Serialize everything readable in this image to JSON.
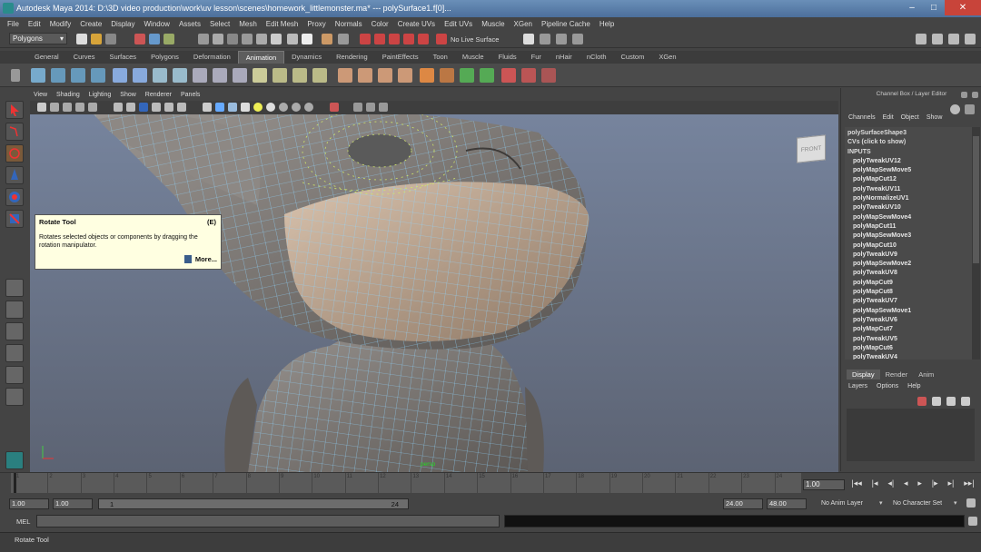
{
  "window": {
    "title": "Autodesk Maya 2014: D:\\3D video production\\work\\uv lesson\\scenes\\homework_littlemonster.ma*   ---   polySurface1.f[0]..."
  },
  "menubar": {
    "items": [
      "File",
      "Edit",
      "Modify",
      "Create",
      "Display",
      "Window",
      "Assets",
      "Select",
      "Mesh",
      "Edit Mesh",
      "Proxy",
      "Normals",
      "Color",
      "Create UVs",
      "Edit UVs",
      "Muscle",
      "XGen",
      "Pipeline Cache",
      "Help"
    ]
  },
  "statusline": {
    "mode": "Polygons",
    "live_surface": "No Live Surface"
  },
  "shelf": {
    "tabs": [
      "General",
      "Curves",
      "Surfaces",
      "Polygons",
      "Deformation",
      "Animation",
      "Dynamics",
      "Rendering",
      "PaintEffects",
      "Toon",
      "Muscle",
      "Fluids",
      "Fur",
      "nHair",
      "nCloth",
      "Custom",
      "XGen"
    ],
    "active_tab": "Animation"
  },
  "viewport": {
    "menu": [
      "View",
      "Shading",
      "Lighting",
      "Show",
      "Renderer",
      "Panels"
    ],
    "viewcube_label": "FRONT",
    "camera_label": "persp"
  },
  "tooltip": {
    "title": "Rotate Tool",
    "hotkey": "(E)",
    "description": "Rotates selected objects or components by dragging the rotation manipulator.",
    "more": "More..."
  },
  "channel_box": {
    "header": "Channel Box / Layer Editor",
    "tabs": [
      "Channels",
      "Edit",
      "Object",
      "Show"
    ],
    "shape": "polySurfaceShape3",
    "cvs": "CVs (click to show)",
    "inputs_label": "INPUTS",
    "inputs": [
      "polyTweakUV12",
      "polyMapSewMove5",
      "polyMapCut12",
      "polyTweakUV11",
      "polyNormalizeUV1",
      "polyTweakUV10",
      "polyMapSewMove4",
      "polyMapCut11",
      "polyMapSewMove3",
      "polyMapCut10",
      "polyTweakUV9",
      "polyMapSewMove2",
      "polyTweakUV8",
      "polyMapCut9",
      "polyMapCut8",
      "polyTweakUV7",
      "polyMapSewMove1",
      "polyTweakUV6",
      "polyMapCut7",
      "polyTweakUV5",
      "polyMapCut6",
      "polyTweakUV4"
    ]
  },
  "layer_editor": {
    "tabs": [
      "Display",
      "Render",
      "Anim"
    ],
    "active_tab": "Display",
    "menu": [
      "Layers",
      "Options",
      "Help"
    ]
  },
  "time_slider": {
    "ticks": [
      "1",
      "2",
      "3",
      "4",
      "5",
      "6",
      "7",
      "8",
      "9",
      "10",
      "11",
      "12",
      "13",
      "14",
      "15",
      "16",
      "17",
      "18",
      "19",
      "20",
      "21",
      "22",
      "23",
      "24"
    ],
    "current_frame": "1.00",
    "playback_buttons": [
      "|◂◂",
      "|◂",
      "◂|",
      "◂",
      "▸",
      "|▸",
      "▸|",
      "▸▸|"
    ]
  },
  "range_slider": {
    "start_time": "1.00",
    "playback_start": "1.00",
    "range_start": "1",
    "range_end": "24",
    "playback_end": "24.00",
    "end_time": "48.00",
    "anim_layer": "No Anim Layer",
    "character_set": "No Character Set"
  },
  "command_line": {
    "label": "MEL"
  },
  "help_line": {
    "text": "Rotate Tool"
  }
}
